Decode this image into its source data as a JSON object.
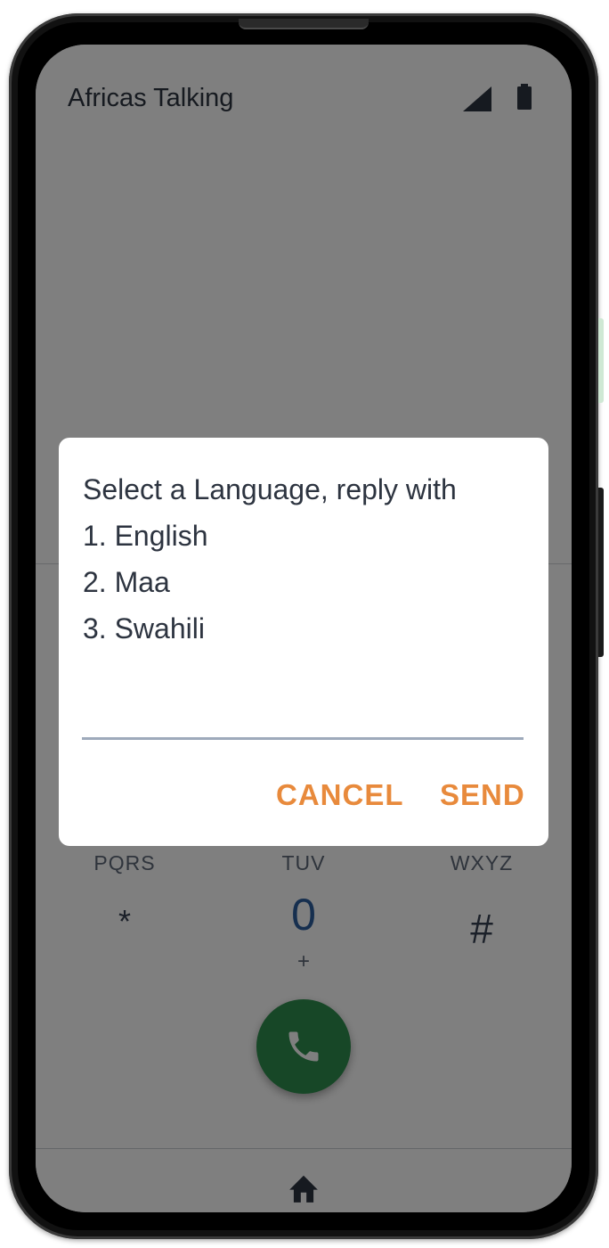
{
  "status_bar": {
    "app_title": "Africas Talking",
    "signal_icon": "cellular-signal-icon",
    "battery_icon": "battery-full-icon"
  },
  "dialer": {
    "keys": [
      {
        "letters": "PQRS",
        "digit": "*",
        "sub": ""
      },
      {
        "letters": "TUV",
        "digit": "0",
        "sub": "+"
      },
      {
        "letters": "WXYZ",
        "digit": "#",
        "sub": ""
      }
    ],
    "call_icon": "phone-icon",
    "call_color": "#2f8f4e"
  },
  "nav": {
    "home_icon": "home-icon"
  },
  "dialog": {
    "message_lines": [
      "Select a Language, reply with",
      "1. English",
      "2. Maa",
      "3. Swahili"
    ],
    "reply_value": "",
    "cancel_label": "CANCEL",
    "send_label": "SEND",
    "accent_color": "#e88a3c"
  }
}
